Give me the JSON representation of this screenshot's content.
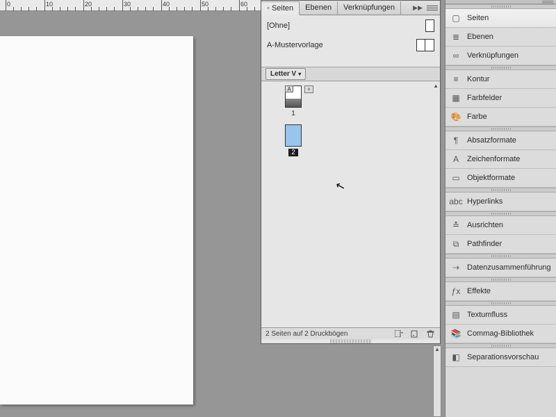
{
  "ruler_marks": [
    0,
    10,
    20,
    30,
    40,
    50,
    60
  ],
  "pages_panel": {
    "tabs": [
      "Seiten",
      "Ebenen",
      "Verknüpfungen"
    ],
    "active_tab": 0,
    "masters": [
      {
        "name": "[Ohne]",
        "spread": 1
      },
      {
        "name": "A-Mustervorlage",
        "spread": 2
      }
    ],
    "page_size_select": "Letter V",
    "pages": [
      {
        "label": "1",
        "selected": false,
        "master_letter": "A",
        "has_detach": true
      },
      {
        "label": "2",
        "selected": true,
        "master_letter": "",
        "has_detach": false
      }
    ],
    "footer_status": "2 Seiten auf 2 Druckbögen"
  },
  "sidebar": {
    "groups": [
      {
        "items": [
          {
            "key": "seiten",
            "label": "Seiten",
            "icon": "pages",
            "active": true
          },
          {
            "key": "ebenen",
            "label": "Ebenen",
            "icon": "layers"
          },
          {
            "key": "verknuepfungen",
            "label": "Verknüpfungen",
            "icon": "links"
          }
        ]
      },
      {
        "items": [
          {
            "key": "kontur",
            "label": "Kontur",
            "icon": "stroke"
          },
          {
            "key": "farbfelder",
            "label": "Farbfelder",
            "icon": "swatches"
          },
          {
            "key": "farbe",
            "label": "Farbe",
            "icon": "palette"
          }
        ]
      },
      {
        "items": [
          {
            "key": "absatzformate",
            "label": "Absatzformate",
            "icon": "para"
          },
          {
            "key": "zeichenformate",
            "label": "Zeichenformate",
            "icon": "char"
          },
          {
            "key": "objektformate",
            "label": "Objektformate",
            "icon": "obj"
          }
        ]
      },
      {
        "items": [
          {
            "key": "hyperlinks",
            "label": "Hyperlinks",
            "icon": "hyper"
          }
        ]
      },
      {
        "items": [
          {
            "key": "ausrichten",
            "label": "Ausrichten",
            "icon": "align"
          },
          {
            "key": "pathfinder",
            "label": "Pathfinder",
            "icon": "pathfinder"
          }
        ]
      },
      {
        "items": [
          {
            "key": "datenz",
            "label": "Datenzusammenführung",
            "icon": "merge"
          }
        ]
      },
      {
        "items": [
          {
            "key": "effekte",
            "label": "Effekte",
            "icon": "fx"
          }
        ]
      },
      {
        "items": [
          {
            "key": "textumfluss",
            "label": "Textumfluss",
            "icon": "wrap"
          },
          {
            "key": "commag",
            "label": "Commag-Bibliothek",
            "icon": "library"
          }
        ]
      },
      {
        "items": [
          {
            "key": "sepvorschau",
            "label": "Separationsvorschau",
            "icon": "sepview"
          }
        ]
      }
    ]
  },
  "icons": {
    "pages": "▢",
    "layers": "≣",
    "links": "∞",
    "stroke": "≡",
    "swatches": "▦",
    "palette": "🎨",
    "para": "¶",
    "char": "A",
    "obj": "▭",
    "hyper": "abc",
    "align": "≛",
    "pathfinder": "⧉",
    "merge": "⇢",
    "fx": "ƒx",
    "wrap": "▤",
    "library": "📚",
    "sepview": "◧"
  }
}
